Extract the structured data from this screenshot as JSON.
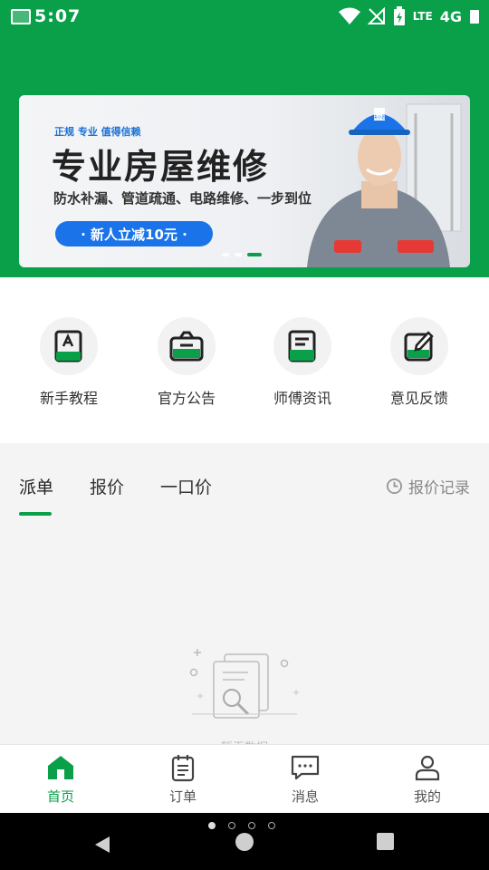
{
  "status": {
    "time": "5:07",
    "network": "LTE",
    "signal_extra": "4G"
  },
  "banner": {
    "tag": "正规 专业 值得信赖",
    "title": "专业房屋维修",
    "subtitle": "防水补漏、管道疏通、电路维修、一步到位",
    "promo": "· 新人立减10元 ·",
    "helmet_text": "快小匠"
  },
  "quick_entries": [
    {
      "label": "新手教程",
      "icon": "book-icon"
    },
    {
      "label": "官方公告",
      "icon": "announcement-icon"
    },
    {
      "label": "师傅资讯",
      "icon": "news-icon"
    },
    {
      "label": "意见反馈",
      "icon": "feedback-icon"
    }
  ],
  "tabs": [
    {
      "label": "派单",
      "active": true
    },
    {
      "label": "报价",
      "active": false
    },
    {
      "label": "一口价",
      "active": false
    }
  ],
  "quote_history": "报价记录",
  "empty_text": "暂无数据",
  "bottom_nav": [
    {
      "label": "首页",
      "icon": "home-icon",
      "active": true
    },
    {
      "label": "订单",
      "icon": "orders-icon",
      "active": false
    },
    {
      "label": "消息",
      "icon": "message-icon",
      "active": false
    },
    {
      "label": "我的",
      "icon": "profile-icon",
      "active": false
    }
  ],
  "colors": {
    "brand": "#0aa04a",
    "promo": "#1a73e8"
  }
}
